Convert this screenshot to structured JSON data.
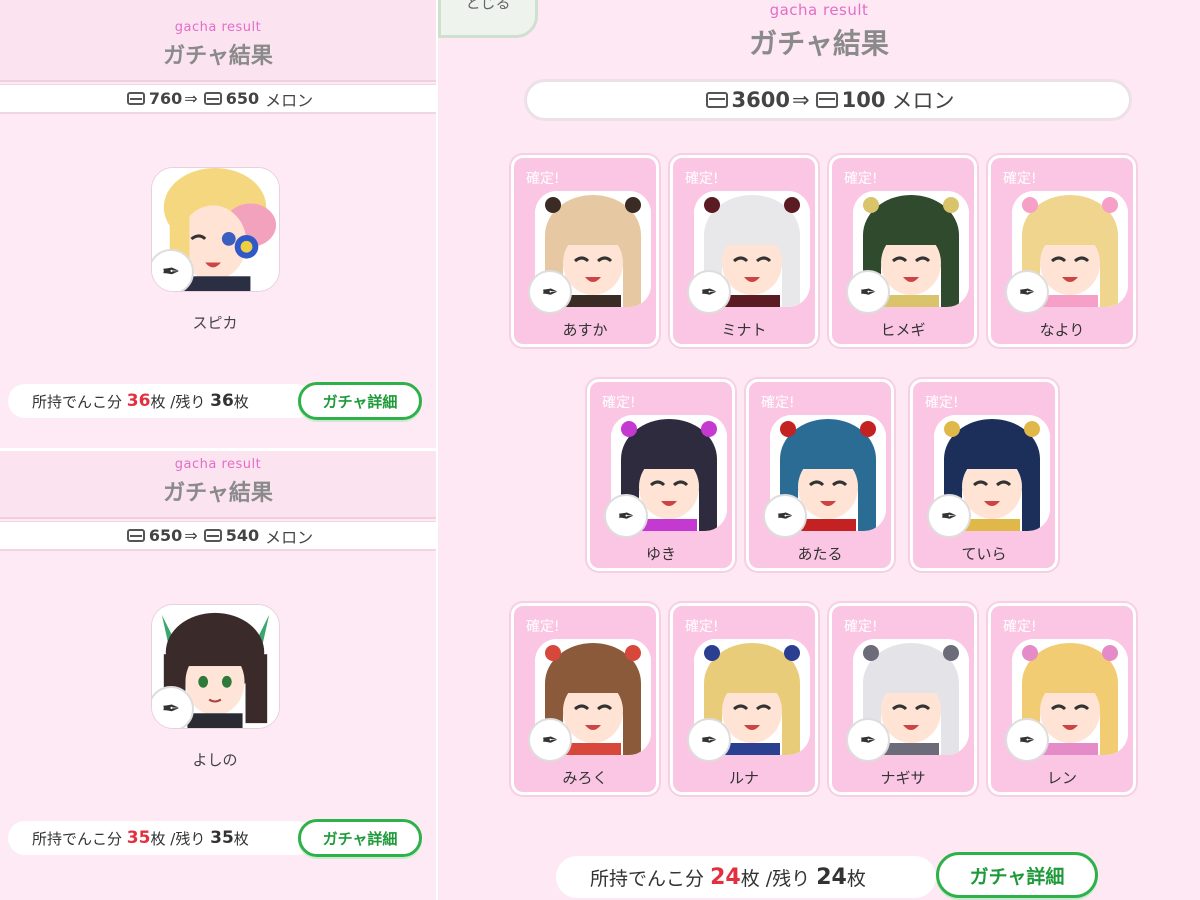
{
  "colors": {
    "accent_pink": "#e36dc9",
    "green": "#2fb14a",
    "red": "#e3303f",
    "card_pink": "#fbc6e4",
    "bg": "#fde8f3"
  },
  "panel_a": {
    "subtitle": "gacha result",
    "title": "ガチャ結果",
    "melon_before": "760",
    "arrow": "⇒",
    "melon_after": "650",
    "unit": "メロン",
    "character": "スピカ",
    "status_prefix": "所持でんこ分",
    "owned_count": "36",
    "count_unit": "枚",
    "remain_prefix": "/残り",
    "remain_count": "36",
    "detail_button": "ガチャ詳細",
    "icon": "feather-icon"
  },
  "panel_b": {
    "subtitle": "gacha result",
    "title": "ガチャ結果",
    "melon_before": "650",
    "arrow": "⇒",
    "melon_after": "540",
    "unit": "メロン",
    "character": "よしの",
    "status_prefix": "所持でんこ分",
    "owned_count": "35",
    "count_unit": "枚",
    "remain_prefix": "/残り",
    "remain_count": "35",
    "detail_button": "ガチャ詳細"
  },
  "main": {
    "close_label": "とじる",
    "subtitle": "gacha result",
    "title": "ガチャ結果",
    "melon_before": "3600",
    "arrow": "⇒",
    "melon_after": "100",
    "unit": "メロン",
    "badge": "確定!",
    "cards": [
      {
        "name": "あすか",
        "hair": "#e6c9a3",
        "accent": "#3b2b25"
      },
      {
        "name": "ミナト",
        "hair": "#e8e8ea",
        "accent": "#5a1c22"
      },
      {
        "name": "ヒメギ",
        "hair": "#2f4a2c",
        "accent": "#d9c36b"
      },
      {
        "name": "なより",
        "hair": "#f0d58f",
        "accent": "#f6a0c8"
      },
      {
        "name": "ゆき",
        "hair": "#2d2b3d",
        "accent": "#c43ad1"
      },
      {
        "name": "あたる",
        "hair": "#2b6c95",
        "accent": "#c42222"
      },
      {
        "name": "ていら",
        "hair": "#1c2e5a",
        "accent": "#e0b84a"
      },
      {
        "name": "みろく",
        "hair": "#8b5a3a",
        "accent": "#d7473b"
      },
      {
        "name": "ルナ",
        "hair": "#e8cc7a",
        "accent": "#2a3f8f"
      },
      {
        "name": "ナギサ",
        "hair": "#e4e4e8",
        "accent": "#6b6b7a"
      },
      {
        "name": "レン",
        "hair": "#f2cc72",
        "accent": "#e58cc8"
      }
    ],
    "status_prefix": "所持でんこ分",
    "owned_count": "24",
    "count_unit": "枚",
    "remain_prefix": "/残り",
    "remain_count": "24",
    "detail_button": "ガチャ詳細"
  }
}
